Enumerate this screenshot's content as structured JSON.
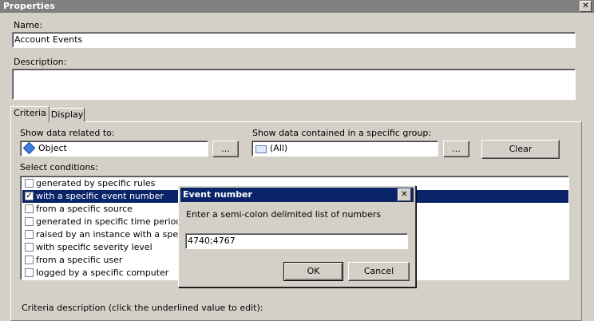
{
  "window": {
    "title": "Properties",
    "close_glyph": "✕"
  },
  "form": {
    "name_label": "Name:",
    "name_value": "Account Events",
    "description_label": "Description:",
    "description_value": ""
  },
  "tabs": [
    {
      "label": "Criteria",
      "active": true
    },
    {
      "label": "Display",
      "active": false
    }
  ],
  "criteria": {
    "related_label": "Show data related to:",
    "related_value": "Object",
    "related_icon": "object-diamond-icon",
    "browse_label": "...",
    "group_label": "Show data contained in a specific group:",
    "group_value": "(All)",
    "group_icon": "group-envelope-icon",
    "group_browse_label": "...",
    "clear_label": "Clear",
    "conditions_label": "Select conditions:",
    "conditions": [
      {
        "label": "generated by specific rules",
        "checked": false,
        "selected": false
      },
      {
        "label": "with a specific event number",
        "checked": true,
        "selected": true
      },
      {
        "label": "from a specific source",
        "checked": false,
        "selected": false
      },
      {
        "label": "generated in specific time period",
        "checked": false,
        "selected": false
      },
      {
        "label": "raised by an instance with a specific n",
        "checked": false,
        "selected": false
      },
      {
        "label": "with specific severity level",
        "checked": false,
        "selected": false
      },
      {
        "label": "from a specific user",
        "checked": false,
        "selected": false
      },
      {
        "label": "logged by a specific computer",
        "checked": false,
        "selected": false
      }
    ],
    "description_label": "Criteria description (click the underlined value to edit):"
  },
  "dialog": {
    "title": "Event number",
    "close_glyph": "✕",
    "prompt": "Enter a semi-colon delimited list of numbers",
    "input_value": "4740;4767",
    "ok_label": "OK",
    "cancel_label": "Cancel"
  },
  "colors": {
    "selection": "#0a246a",
    "window_bg": "#d4d0c8",
    "inactive_title": "#808080"
  }
}
